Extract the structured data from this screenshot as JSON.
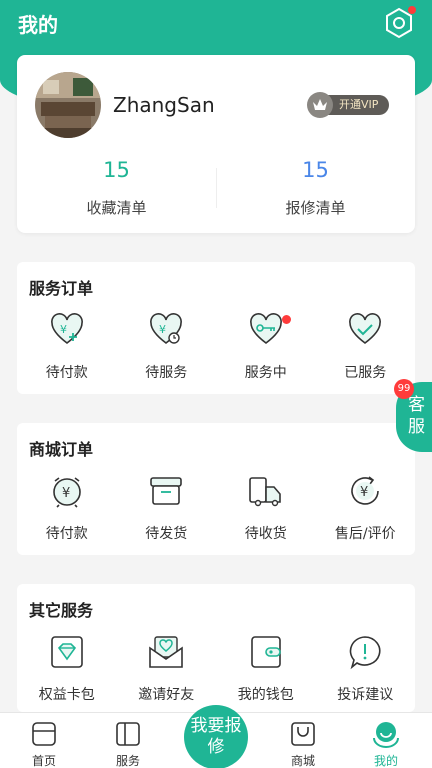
{
  "header": {
    "title": "我的"
  },
  "profile": {
    "username": "ZhangSan",
    "vip_label": "开通VIP",
    "stats": [
      {
        "value": "15",
        "label": "收藏清单"
      },
      {
        "value": "15",
        "label": "报修清单"
      }
    ]
  },
  "service_orders": {
    "title": "服务订单",
    "items": [
      {
        "label": "待付款",
        "icon": "heart-yen-plus-icon"
      },
      {
        "label": "待服务",
        "icon": "heart-yen-clock-icon"
      },
      {
        "label": "服务中",
        "icon": "heart-key-icon"
      },
      {
        "label": "已服务",
        "icon": "heart-check-icon"
      }
    ]
  },
  "mall_orders": {
    "title": "商城订单",
    "items": [
      {
        "label": "待付款",
        "icon": "yen-clock-icon"
      },
      {
        "label": "待发货",
        "icon": "box-icon"
      },
      {
        "label": "待收货",
        "icon": "truck-icon"
      },
      {
        "label": "售后/评价",
        "icon": "yen-refund-icon"
      }
    ]
  },
  "other_services": {
    "title": "其它服务",
    "items": [
      {
        "label": "权益卡包",
        "icon": "diamond-card-icon"
      },
      {
        "label": "邀请好友",
        "icon": "envelope-heart-icon"
      },
      {
        "label": "我的钱包",
        "icon": "wallet-icon"
      },
      {
        "label": "投诉建议",
        "icon": "speech-exclamation-icon"
      }
    ]
  },
  "floating_service": {
    "label": "客服",
    "badge": "99"
  },
  "tabbar": {
    "home": "首页",
    "service": "服务",
    "repair": "我要报修",
    "mall": "商城",
    "me": "我的"
  },
  "colors": {
    "primary": "#1fb595",
    "blue": "#4a86e8",
    "red": "#ff3b3b"
  }
}
